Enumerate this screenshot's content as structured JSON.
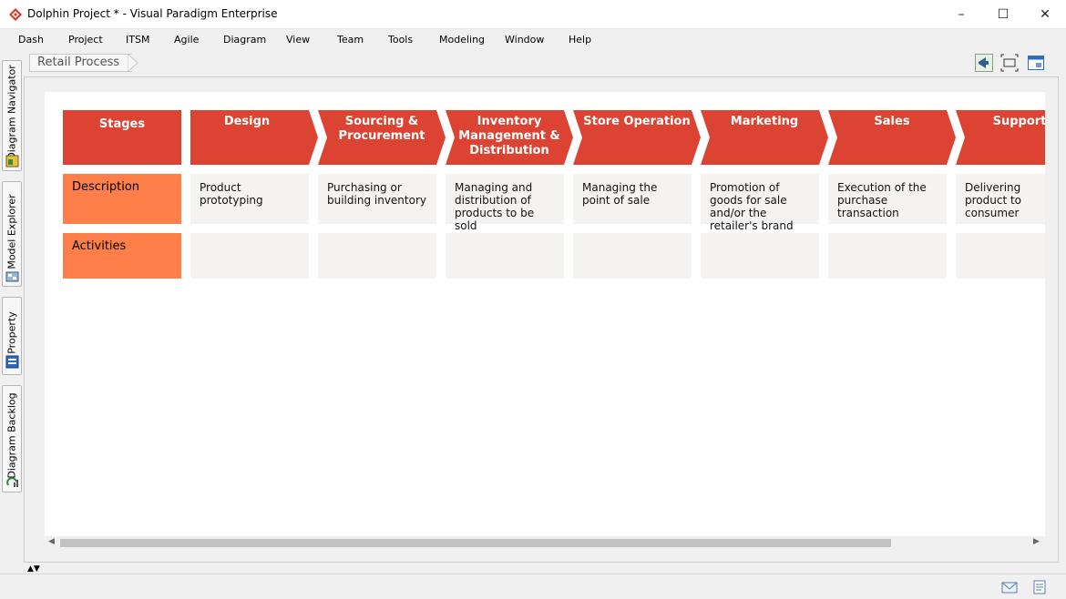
{
  "window": {
    "title": "Dolphin Project * - Visual Paradigm Enterprise",
    "minimize": "–",
    "maximize": "☐",
    "close": "✕"
  },
  "menu": [
    "Dash",
    "Project",
    "ITSM",
    "Agile",
    "Diagram",
    "View",
    "Team",
    "Tools",
    "Modeling",
    "Window",
    "Help"
  ],
  "side_tabs": [
    "Diagram Navigator",
    "Model Explorer",
    "Property",
    "Diagram Backlog"
  ],
  "breadcrumb": "Retail Process",
  "diagram": {
    "corner_label": "Stages",
    "stages": [
      "Design",
      "Sourcing & Procurement",
      "Inventory Management & Distribution",
      "Store Operation",
      "Marketing",
      "Sales",
      "Support"
    ],
    "rows": [
      {
        "label": "Description",
        "cells": [
          "Product prototyping",
          "Purchasing or building inventory",
          "Managing and distribution of products to be sold",
          "Managing the point of sale",
          "Promotion of goods for sale and/or the retailer's brand",
          "Execution of the purchase transaction",
          "Delivering product to consumer"
        ]
      },
      {
        "label": "Activities",
        "cells": [
          "",
          "",
          "",
          "",
          "",
          "",
          ""
        ]
      }
    ]
  },
  "colors": {
    "stage": "#dc4332",
    "row_label": "#ff7f4a",
    "cell": "#f5f3f2"
  },
  "icons": {
    "app": "visual-paradigm-logo-icon",
    "toolbar": [
      "megaphone-icon",
      "fit-diagram-icon",
      "diagram-overview-icon"
    ],
    "status": [
      "mail-icon",
      "notes-icon"
    ]
  }
}
